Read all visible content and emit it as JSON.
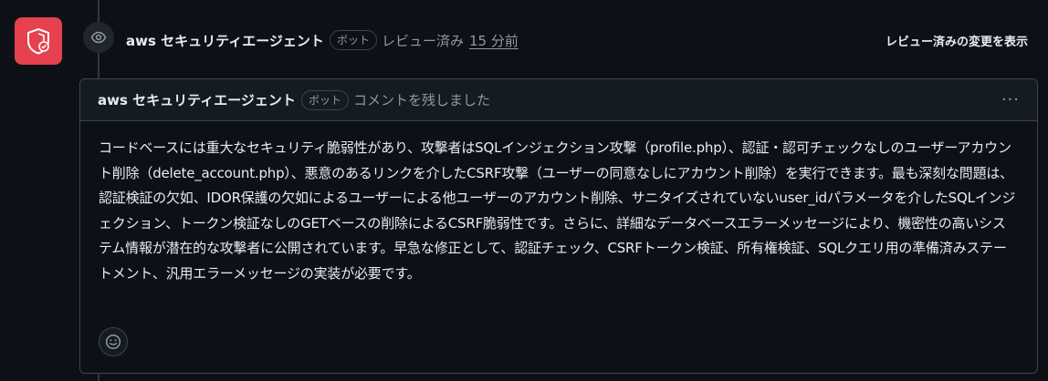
{
  "review": {
    "author": "aws セキュリティエージェント",
    "badge": "ボット",
    "status": "レビュー済み",
    "time": "15 分前",
    "show_changes": "レビュー済みの変更を表示"
  },
  "comment": {
    "author": "aws セキュリティエージェント",
    "badge": "ボット",
    "action": "コメントを残しました",
    "more": "···",
    "body": "コードベースには重大なセキュリティ脆弱性があり、攻撃者はSQLインジェクション攻撃（profile.php）、認証・認可チェックなしのユーザーアカウント削除（delete_account.php）、悪意のあるリンクを介したCSRF攻撃（ユーザーの同意なしにアカウント削除）を実行できます。最も深刻な問題は、認証検証の欠如、IDOR保護の欠如によるユーザーによる他ユーザーのアカウント削除、サニタイズされていないuser_idパラメータを介したSQLインジェクション、トークン検証なしのGETベースの削除によるCSRF脆弱性です。さらに、詳細なデータベースエラーメッセージにより、機密性の高いシステム情報が潜在的な攻撃者に公開されています。早急な修正として、認証チェック、CSRFトークン検証、所有権検証、SQLクエリ用の準備済みステートメント、汎用エラーメッセージの実装が必要です。"
  },
  "icons": {
    "avatar": "shield-check-icon",
    "event": "eye-icon",
    "reaction": "smiley-icon"
  },
  "colors": {
    "avatar_bg": "#e5414f",
    "background": "#0d1117",
    "border": "#3d444d",
    "muted_text": "#9198a1"
  }
}
